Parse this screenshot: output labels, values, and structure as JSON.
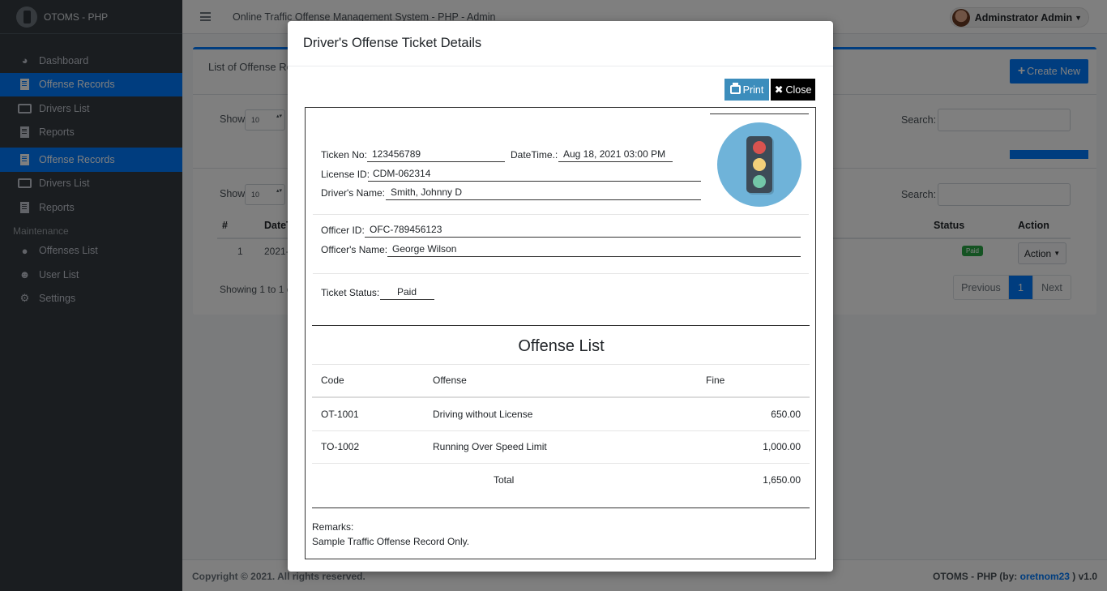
{
  "app": {
    "brand": "OTOMS - PHP",
    "top_title": "Online Traffic Offense Management System - PHP - Admin",
    "user_name": "Adminstrator Admin"
  },
  "sidebar": {
    "items": [
      {
        "label": "Dashboard",
        "icon": "dashboard-icon"
      },
      {
        "label": "Offense Records",
        "icon": "file-icon",
        "active": true
      },
      {
        "label": "Drivers List",
        "icon": "id-card-icon"
      },
      {
        "label": "Reports",
        "icon": "file-icon"
      },
      {
        "label": "Offense Records",
        "icon": "file-icon",
        "active": true
      },
      {
        "label": "Drivers List",
        "icon": "id-card-icon"
      },
      {
        "label": "Reports",
        "icon": "file-icon"
      }
    ],
    "maintenance_header": "Maintenance",
    "maintenance_items": [
      {
        "label": "Offenses List",
        "icon": "traffic-light-icon"
      },
      {
        "label": "User List",
        "icon": "users-icon"
      },
      {
        "label": "Settings",
        "icon": "gears-icon"
      }
    ]
  },
  "background_card": {
    "title": "List of Offense Re",
    "create_label": "Create New",
    "show_label": "Show",
    "show_value": "10",
    "search_label": "Search:",
    "columns": {
      "num": "#",
      "date": "DateT",
      "status": "Status",
      "action": "Action"
    },
    "row": {
      "num": "1",
      "date": "2021-",
      "status": "Paid",
      "action": "Action"
    },
    "showing": "Showing 1 to 1 o",
    "pager": {
      "prev": "Previous",
      "current": "1",
      "next": "Next"
    }
  },
  "footer": {
    "copyright": "Copyright © 2021. All rights reserved.",
    "right_prefix": "OTOMS - PHP (by: ",
    "right_link": "oretnom23",
    "right_suffix": " ) v1.0"
  },
  "modal": {
    "title": "Driver's Offense Ticket Details",
    "print_label": "Print",
    "close_label": "Close",
    "ticket": {
      "ticket_no_label": "Ticken No:",
      "ticket_no": "123456789",
      "datetime_label": "DateTime.:",
      "datetime": "Aug 18, 2021 03:00 PM",
      "license_label": "License ID:",
      "license": "CDM-062314",
      "driver_label": "Driver's Name:",
      "driver": "Smith, Johnny D",
      "officer_id_label": "Officer ID:",
      "officer_id": "OFC-789456123",
      "officer_name_label": "Officer's Name:",
      "officer_name": "George Wilson",
      "status_label": "Ticket Status:",
      "status": "Paid"
    },
    "offense_list": {
      "title": "Offense List",
      "headers": {
        "code": "Code",
        "offense": "Offense",
        "fine": "Fine"
      },
      "rows": [
        {
          "code": "OT-1001",
          "offense": "Driving without License",
          "fine": "650.00"
        },
        {
          "code": "TO-1002",
          "offense": "Running Over Speed Limit",
          "fine": "1,000.00"
        }
      ],
      "total_label": "Total",
      "total": "1,650.00"
    },
    "remarks_label": "Remarks:",
    "remarks": "Sample Traffic Offense Record Only."
  },
  "colors": {
    "primary": "#007bff",
    "sidebar": "#343a40",
    "print_button": "#3c8dbc",
    "paid_badge": "#28a745"
  }
}
